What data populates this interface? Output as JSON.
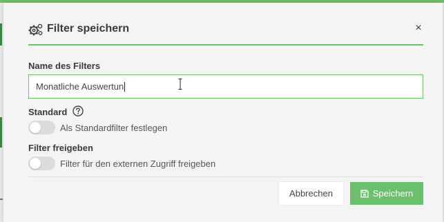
{
  "colors": {
    "accent": "#6cbf6c",
    "background": "#f4f4f4",
    "toggle_off": "#dcdcdc"
  },
  "dialog": {
    "title": "Filter speichern",
    "title_icon": "gears-icon",
    "close_label": "×"
  },
  "form": {
    "name_label": "Name des Filters",
    "name_value": "Monatliche Auswertun",
    "standard_label": "Standard",
    "standard_help_icon": "question-circle-icon",
    "standard_toggle_text": "Als Standardfilter festlegen",
    "standard_toggle_on": false,
    "share_label": "Filter freigeben",
    "share_toggle_text": "Filter für den externen Zugriff freigeben",
    "share_toggle_on": false
  },
  "footer": {
    "cancel_label": "Abbrechen",
    "save_label": "Speichern",
    "save_icon": "floppy-disk-icon"
  }
}
